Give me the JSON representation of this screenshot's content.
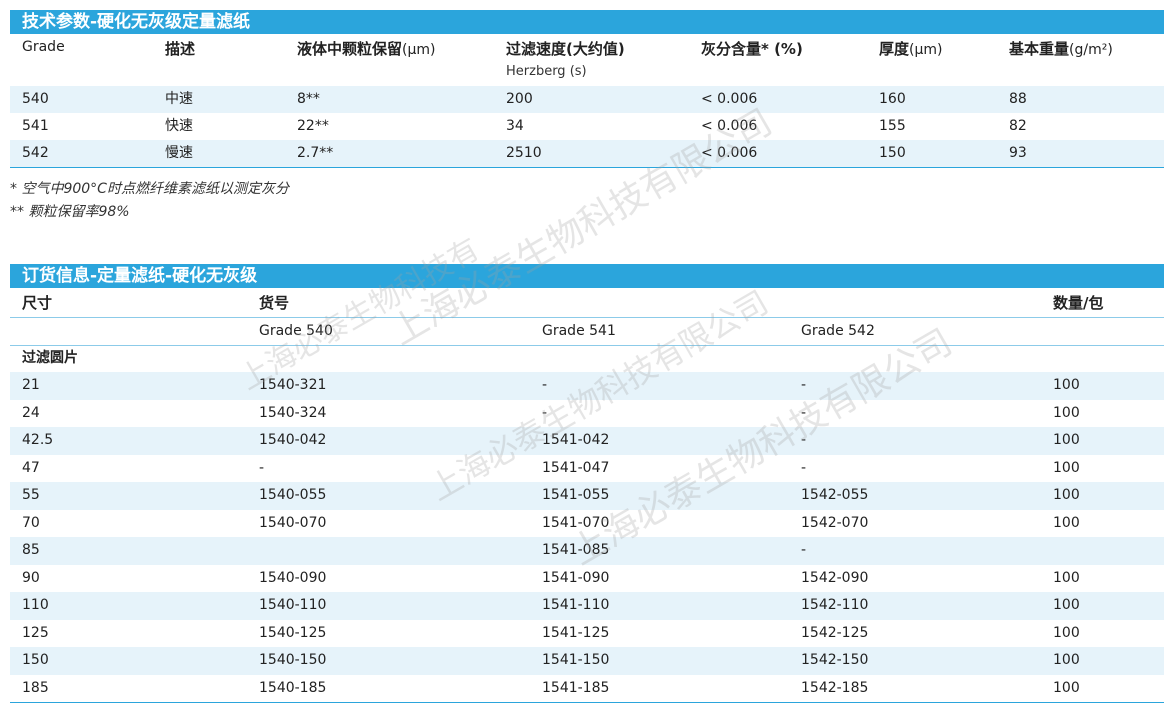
{
  "spec": {
    "title": "技术参数-硬化无灰级定量滤纸",
    "headers": {
      "grade": "Grade",
      "desc": "描述",
      "retention": "液体中颗粒保留",
      "retention_unit": "(μm)",
      "speed": "过滤速度(大约值)",
      "speed_sub": "Herzberg (s)",
      "ash": "灰分含量* (%)",
      "thickness": "厚度",
      "thickness_unit": "(μm)",
      "weight": "基本重量",
      "weight_unit": "(g/m²)"
    },
    "rows": [
      {
        "grade": "540",
        "desc": "中速",
        "retention": "8**",
        "speed": "200",
        "ash": "< 0.006",
        "thickness": "160",
        "weight": "88"
      },
      {
        "grade": "541",
        "desc": "快速",
        "retention": "22**",
        "speed": "34",
        "ash": "< 0.006",
        "thickness": "155",
        "weight": "82"
      },
      {
        "grade": "542",
        "desc": "慢速",
        "retention": "2.7**",
        "speed": "2510",
        "ash": "< 0.006",
        "thickness": "150",
        "weight": "93"
      }
    ],
    "notes": [
      "* 空气中900°C时点燃纤维素滤纸以测定灰分",
      "** 颗粒保留率98%"
    ]
  },
  "order": {
    "title": "订货信息-定量滤纸-硬化无灰级",
    "headers": {
      "size": "尺寸",
      "catalog": "货号",
      "qty": "数量/包",
      "g540": "Grade 540",
      "g541": "Grade 541",
      "g542": "Grade 542"
    },
    "group_label": "过滤圆片",
    "rows": [
      {
        "size": "21",
        "g540": "1540-321",
        "g541": "-",
        "g542": "-",
        "qty": "100"
      },
      {
        "size": "24",
        "g540": "1540-324",
        "g541": "-",
        "g542": "-",
        "qty": "100"
      },
      {
        "size": "42.5",
        "g540": "1540-042",
        "g541": "1541-042",
        "g542": "-",
        "qty": "100"
      },
      {
        "size": "47",
        "g540": "-",
        "g541": "1541-047",
        "g542": "-",
        "qty": "100"
      },
      {
        "size": "55",
        "g540": "1540-055",
        "g541": "1541-055",
        "g542": "1542-055",
        "qty": "100"
      },
      {
        "size": "70",
        "g540": "1540-070",
        "g541": "1541-070",
        "g542": "1542-070",
        "qty": "100"
      },
      {
        "size": "85",
        "g540": "",
        "g541": "1541-085",
        "g542": "-",
        "qty": ""
      },
      {
        "size": "90",
        "g540": "1540-090",
        "g541": "1541-090",
        "g542": "1542-090",
        "qty": "100"
      },
      {
        "size": "110",
        "g540": "1540-110",
        "g541": "1541-110",
        "g542": "1542-110",
        "qty": "100"
      },
      {
        "size": "125",
        "g540": "1540-125",
        "g541": "1541-125",
        "g542": "1542-125",
        "qty": "100"
      },
      {
        "size": "150",
        "g540": "1540-150",
        "g541": "1541-150",
        "g542": "1542-150",
        "qty": "100"
      },
      {
        "size": "185",
        "g540": "1540-185",
        "g541": "1541-185",
        "g542": "1542-185",
        "qty": "100"
      }
    ]
  },
  "watermark": {
    "lines": [
      "上海必泰生物科技有限公司",
      "上海必泰生物科技有限公司",
      "上海必泰生物科技有限公司",
      "上海必泰生物科技有"
    ]
  },
  "colors": {
    "accent": "#2ba5dc",
    "stripe": "#e6f3fa"
  }
}
